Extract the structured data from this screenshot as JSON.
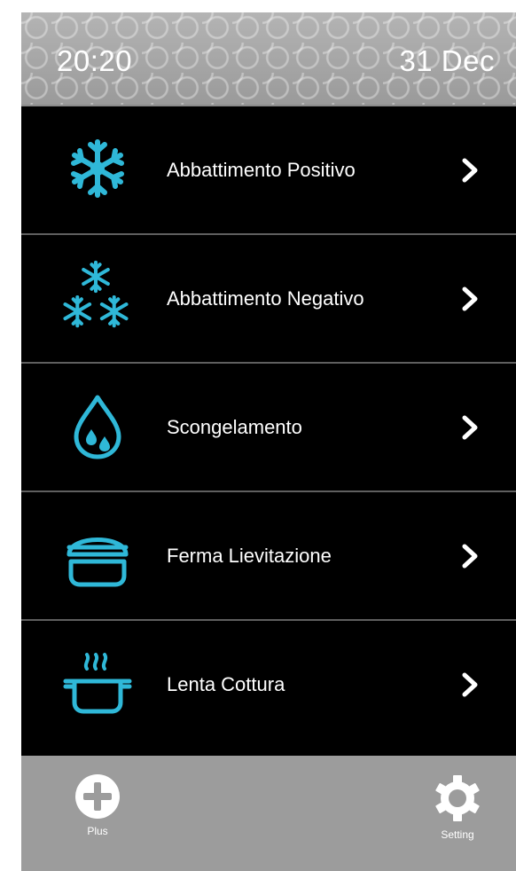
{
  "header": {
    "time": "20:20",
    "date": "31 Dec"
  },
  "menu": {
    "items": [
      {
        "label": "Abbattimento Positivo",
        "icon": "snowflake-icon"
      },
      {
        "label": "Abbattimento Negativo",
        "icon": "triple-snowflake-icon"
      },
      {
        "label": "Scongelamento",
        "icon": "water-drop-icon"
      },
      {
        "label": "Ferma Lievitazione",
        "icon": "dough-bowl-icon"
      },
      {
        "label": "Lenta Cottura",
        "icon": "cooking-pot-icon"
      }
    ]
  },
  "footer": {
    "plus_label": "Plus",
    "setting_label": "Setting"
  },
  "colors": {
    "accent": "#2fb8d8",
    "background": "#000000",
    "header": "#a3a3a3",
    "footer": "#9c9c9c",
    "divider": "#5f5f5f"
  }
}
